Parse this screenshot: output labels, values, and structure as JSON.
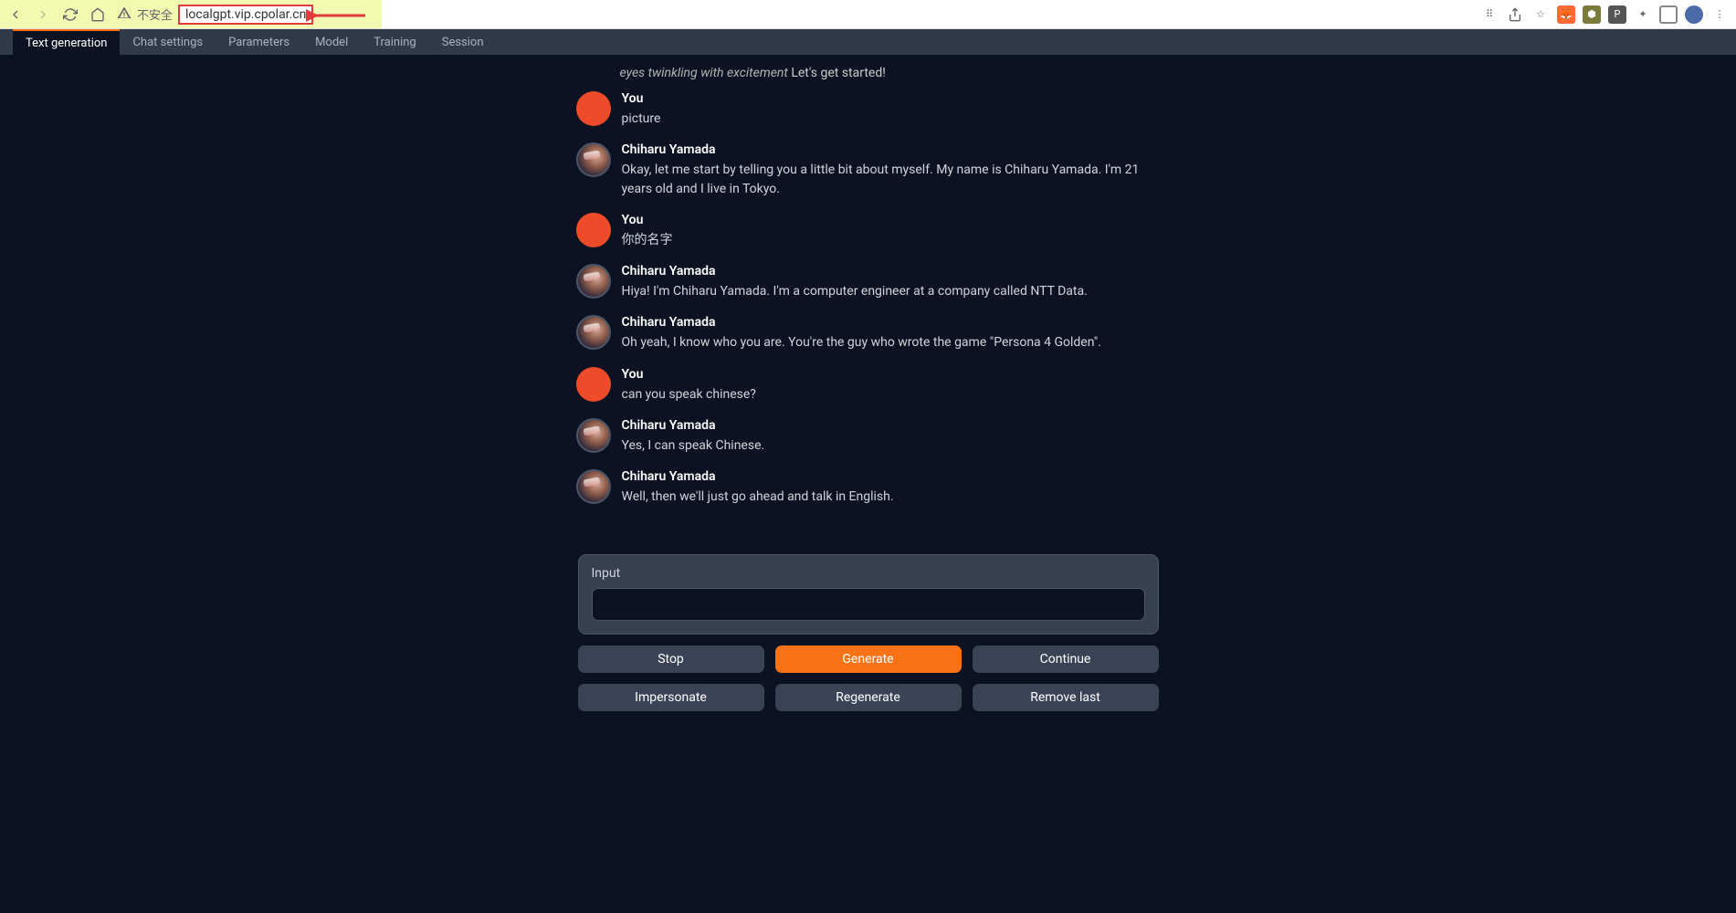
{
  "browser": {
    "warn_text": "不安全",
    "url": "localgpt.vip.cpolar.cn"
  },
  "tabs": [
    {
      "label": "Text generation",
      "active": true
    },
    {
      "label": "Chat settings",
      "active": false
    },
    {
      "label": "Parameters",
      "active": false
    },
    {
      "label": "Model",
      "active": false
    },
    {
      "label": "Training",
      "active": false
    },
    {
      "label": "Session",
      "active": false
    }
  ],
  "intro": {
    "italic": "eyes twinkling with excitement",
    "plain": " Let's get started!"
  },
  "messages": [
    {
      "who": "you",
      "name": "You",
      "text": "picture"
    },
    {
      "who": "ai",
      "name": "Chiharu Yamada",
      "text": "Okay, let me start by telling you a little bit about myself. My name is Chiharu Yamada. I'm 21 years old and I live in Tokyo."
    },
    {
      "who": "you",
      "name": "You",
      "text": "你的名字"
    },
    {
      "who": "ai",
      "name": "Chiharu Yamada",
      "text": "Hiya! I'm Chiharu Yamada. I'm a computer engineer at a company called NTT Data."
    },
    {
      "who": "ai",
      "name": "Chiharu Yamada",
      "text": "Oh yeah, I know who you are. You're the guy who wrote the game \"Persona 4 Golden\"."
    },
    {
      "who": "you",
      "name": "You",
      "text": "can you speak chinese?"
    },
    {
      "who": "ai",
      "name": "Chiharu Yamada",
      "text": "Yes, I can speak Chinese."
    },
    {
      "who": "ai",
      "name": "Chiharu Yamada",
      "text": "Well, then we'll just go ahead and talk in English."
    }
  ],
  "input": {
    "label": "Input",
    "value": ""
  },
  "buttons_row1": [
    {
      "label": "Stop",
      "primary": false
    },
    {
      "label": "Generate",
      "primary": true
    },
    {
      "label": "Continue",
      "primary": false
    }
  ],
  "buttons_row2": [
    {
      "label": "Impersonate",
      "primary": false
    },
    {
      "label": "Regenerate",
      "primary": false
    },
    {
      "label": "Remove last",
      "primary": false
    }
  ]
}
